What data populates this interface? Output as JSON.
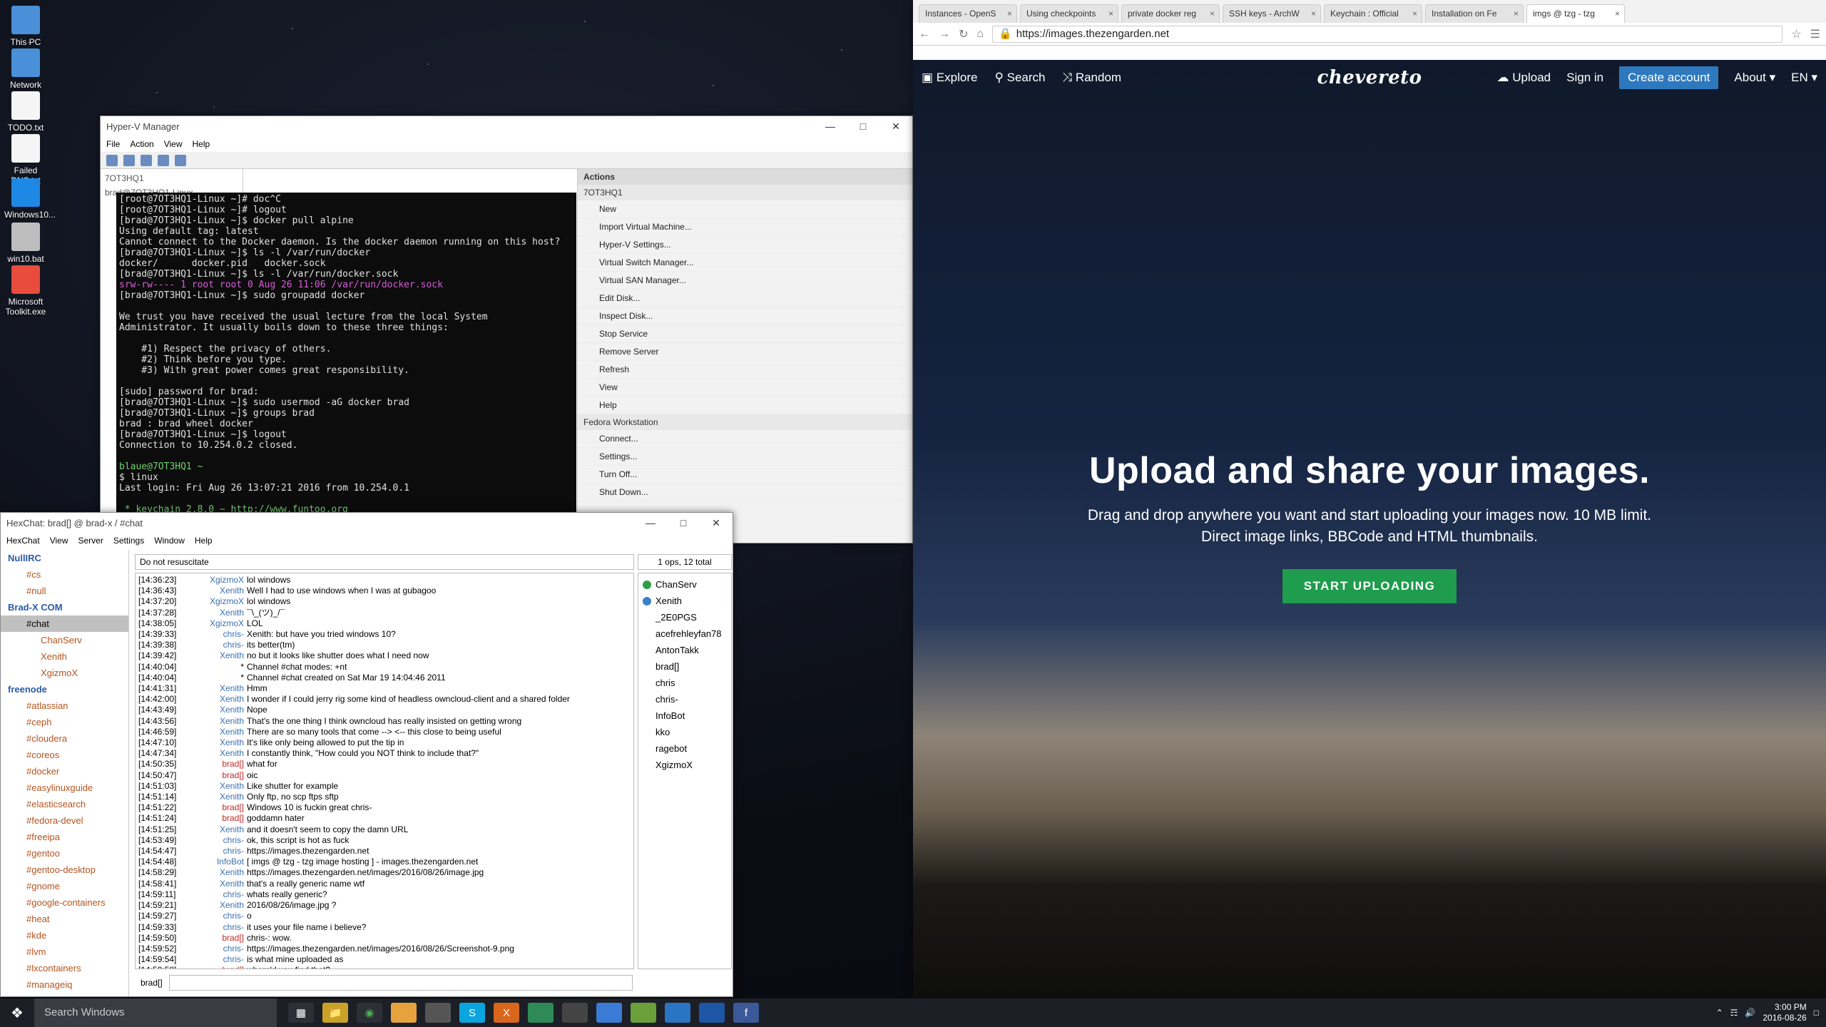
{
  "desktop": {
    "icons": [
      {
        "label": "This PC"
      },
      {
        "label": "Network"
      },
      {
        "label": "TODO.txt"
      },
      {
        "label": "Failed DNS.txt"
      },
      {
        "label": "Windows10..."
      },
      {
        "label": "win10.bat"
      },
      {
        "label": "Microsoft Toolkit.exe"
      }
    ]
  },
  "hyperv": {
    "title": "Hyper-V Manager",
    "menu": [
      "File",
      "Action",
      "View",
      "Help"
    ],
    "tree_item": "7OT3HQ1",
    "vm_tab": "brad@7OT3HQ1-Linux",
    "actions_header": "Actions",
    "actions_host": "7OT3HQ1",
    "actions": [
      "New",
      "Import Virtual Machine...",
      "Hyper-V Settings...",
      "Virtual Switch Manager...",
      "Virtual SAN Manager...",
      "Edit Disk...",
      "Inspect Disk...",
      "Stop Service",
      "Remove Server",
      "Refresh",
      "View",
      "Help"
    ],
    "actions_vm": "Fedora Workstation",
    "vm_actions": [
      "Connect...",
      "Settings...",
      "Turn Off...",
      "Shut Down..."
    ]
  },
  "terminal": {
    "lines": [
      {
        "t": "[root@7OT3HQ1-Linux ~]# doc^C",
        "c": ""
      },
      {
        "t": "[root@7OT3HQ1-Linux ~]# logout",
        "c": ""
      },
      {
        "t": "[brad@7OT3HQ1-Linux ~]$ docker pull alpine",
        "c": ""
      },
      {
        "t": "Using default tag: latest",
        "c": ""
      },
      {
        "t": "Cannot connect to the Docker daemon. Is the docker daemon running on this host?",
        "c": ""
      },
      {
        "t": "[brad@7OT3HQ1-Linux ~]$ ls -l /var/run/docker",
        "c": ""
      },
      {
        "t": "docker/      docker.pid   docker.sock",
        "c": ""
      },
      {
        "t": "[brad@7OT3HQ1-Linux ~]$ ls -l /var/run/docker.sock",
        "c": ""
      },
      {
        "t": "srw-rw---- 1 root root 0 Aug 26 11:06 /var/run/docker.sock",
        "c": "hl"
      },
      {
        "t": "[brad@7OT3HQ1-Linux ~]$ sudo groupadd docker",
        "c": ""
      },
      {
        "t": "",
        "c": ""
      },
      {
        "t": "We trust you have received the usual lecture from the local System",
        "c": ""
      },
      {
        "t": "Administrator. It usually boils down to these three things:",
        "c": ""
      },
      {
        "t": "",
        "c": ""
      },
      {
        "t": "    #1) Respect the privacy of others.",
        "c": ""
      },
      {
        "t": "    #2) Think before you type.",
        "c": ""
      },
      {
        "t": "    #3) With great power comes great responsibility.",
        "c": ""
      },
      {
        "t": "",
        "c": ""
      },
      {
        "t": "[sudo] password for brad:",
        "c": ""
      },
      {
        "t": "[brad@7OT3HQ1-Linux ~]$ sudo usermod -aG docker brad",
        "c": ""
      },
      {
        "t": "[brad@7OT3HQ1-Linux ~]$ groups brad",
        "c": ""
      },
      {
        "t": "brad : brad wheel docker",
        "c": ""
      },
      {
        "t": "[brad@7OT3HQ1-Linux ~]$ logout",
        "c": ""
      },
      {
        "t": "Connection to 10.254.0.2 closed.",
        "c": ""
      },
      {
        "t": "",
        "c": ""
      },
      {
        "t": "blaue@7OT3HQ1 ~",
        "c": "prompt"
      },
      {
        "t": "$ linux",
        "c": ""
      },
      {
        "t": "Last login: Fri Aug 26 13:07:21 2016 from 10.254.0.1",
        "c": ""
      },
      {
        "t": "",
        "c": ""
      },
      {
        "t": " * keychain 2.8.0 ~ http://www.funtoo.org",
        "c": "tty"
      }
    ]
  },
  "hexchat": {
    "title": "HexChat: brad[] @ brad-x / #chat",
    "menu": [
      "HexChat",
      "View",
      "Server",
      "Settings",
      "Window",
      "Help"
    ],
    "tree": [
      {
        "label": "NullIRC",
        "kind": "net"
      },
      {
        "label": "#cs",
        "kind": "chan"
      },
      {
        "label": "#null",
        "kind": "chan"
      },
      {
        "label": "Brad-X COM",
        "kind": "net"
      },
      {
        "label": "#chat",
        "kind": "chan sel"
      },
      {
        "label": "ChanServ",
        "kind": "user"
      },
      {
        "label": "Xenith",
        "kind": "user"
      },
      {
        "label": "XgizmoX",
        "kind": "user"
      },
      {
        "label": "freenode",
        "kind": "net"
      },
      {
        "label": "#atlassian",
        "kind": "chan"
      },
      {
        "label": "#ceph",
        "kind": "chan"
      },
      {
        "label": "#cloudera",
        "kind": "chan"
      },
      {
        "label": "#coreos",
        "kind": "chan"
      },
      {
        "label": "#docker",
        "kind": "chan"
      },
      {
        "label": "#easylinuxguide",
        "kind": "chan"
      },
      {
        "label": "#elasticsearch",
        "kind": "chan"
      },
      {
        "label": "#fedora-devel",
        "kind": "chan"
      },
      {
        "label": "#freeipa",
        "kind": "chan"
      },
      {
        "label": "#gentoo",
        "kind": "chan"
      },
      {
        "label": "#gentoo-desktop",
        "kind": "chan"
      },
      {
        "label": "#gnome",
        "kind": "chan"
      },
      {
        "label": "#google-containers",
        "kind": "chan"
      },
      {
        "label": "#heat",
        "kind": "chan"
      },
      {
        "label": "#kde",
        "kind": "chan"
      },
      {
        "label": "#lvm",
        "kind": "chan"
      },
      {
        "label": "#lxcontainers",
        "kind": "chan"
      },
      {
        "label": "#manageiq",
        "kind": "chan"
      }
    ],
    "topic": "Do not resuscitate",
    "ops": "1 ops, 12 total",
    "log": [
      {
        "ts": "[14:36:23]",
        "nick": "XgizmoX",
        "color": "#3a6fb0",
        "msg": "lol windows"
      },
      {
        "ts": "[14:36:43]",
        "nick": "Xenith",
        "color": "#3a6fb0",
        "msg": "Well I had to use windows when I was at gubagoo"
      },
      {
        "ts": "[14:37:20]",
        "nick": "XgizmoX",
        "color": "#3a6fb0",
        "msg": "lol windows"
      },
      {
        "ts": "[14:37:28]",
        "nick": "Xenith",
        "color": "#3a6fb0",
        "msg": "¯\\_(ツ)_/¯"
      },
      {
        "ts": "[14:38:05]",
        "nick": "XgizmoX",
        "color": "#3a6fb0",
        "msg": "LOL"
      },
      {
        "ts": "[14:39:33]",
        "nick": "chris-",
        "color": "#3a6fb0",
        "msg": "Xenith: but have you tried windows 10?"
      },
      {
        "ts": "[14:39:38]",
        "nick": "chris-",
        "color": "#3a6fb0",
        "msg": "its better(tm)"
      },
      {
        "ts": "[14:39:42]",
        "nick": "Xenith",
        "color": "#3a6fb0",
        "msg": "no but it looks like shutter does what I need now"
      },
      {
        "ts": "[14:40:04]",
        "nick": "*",
        "color": "#000",
        "msg": "Channel #chat modes: +nt"
      },
      {
        "ts": "[14:40:04]",
        "nick": "*",
        "color": "#000",
        "msg": "Channel #chat created on Sat Mar 19 14:04:46 2011"
      },
      {
        "ts": "[14:41:31]",
        "nick": "Xenith",
        "color": "#3a6fb0",
        "msg": "Hmm"
      },
      {
        "ts": "[14:42:00]",
        "nick": "Xenith",
        "color": "#3a6fb0",
        "msg": "I wonder if I could jerry rig some kind of headless owncloud-client and a shared folder"
      },
      {
        "ts": "[14:43:49]",
        "nick": "Xenith",
        "color": "#3a6fb0",
        "msg": "Nope"
      },
      {
        "ts": "[14:43:56]",
        "nick": "Xenith",
        "color": "#3a6fb0",
        "msg": "That's the one thing I think owncloud has really insisted on getting wrong"
      },
      {
        "ts": "[14:46:59]",
        "nick": "Xenith",
        "color": "#3a6fb0",
        "msg": "There are so many tools that come --> <-- this close to being useful"
      },
      {
        "ts": "[14:47:10]",
        "nick": "Xenith",
        "color": "#3a6fb0",
        "msg": "It's like only being allowed to put the tip in"
      },
      {
        "ts": "[14:47:34]",
        "nick": "Xenith",
        "color": "#3a6fb0",
        "msg": "I constantly think, \"How could you NOT think to include that?\""
      },
      {
        "ts": "[14:50:35]",
        "nick": "brad[]",
        "color": "#c62828",
        "msg": "what for"
      },
      {
        "ts": "[14:50:47]",
        "nick": "brad[]",
        "color": "#c62828",
        "msg": "oic"
      },
      {
        "ts": "[14:51:03]",
        "nick": "Xenith",
        "color": "#3a6fb0",
        "msg": "Like shutter for example"
      },
      {
        "ts": "[14:51:14]",
        "nick": "Xenith",
        "color": "#3a6fb0",
        "msg": "Only ftp, no scp ftps sftp"
      },
      {
        "ts": "[14:51:22]",
        "nick": "brad[]",
        "color": "#c62828",
        "msg": "Windows 10 is fuckin great chris-"
      },
      {
        "ts": "[14:51:24]",
        "nick": "brad[]",
        "color": "#c62828",
        "msg": "goddamn hater"
      },
      {
        "ts": "[14:51:25]",
        "nick": "Xenith",
        "color": "#3a6fb0",
        "msg": "and it doesn't seem to copy the damn URL"
      },
      {
        "ts": "[14:53:49]",
        "nick": "chris-",
        "color": "#3a6fb0",
        "msg": "ok, this script is hot as fuck"
      },
      {
        "ts": "[14:54:47]",
        "nick": "chris-",
        "color": "#3a6fb0",
        "msg": "https://images.thezengarden.net"
      },
      {
        "ts": "[14:54:48]",
        "nick": "InfoBot",
        "color": "#3a6fb0",
        "msg": "[ imgs @ tzg - tzg image hosting ] - images.thezengarden.net"
      },
      {
        "ts": "[14:58:29]",
        "nick": "Xenith",
        "color": "#3a6fb0",
        "msg": "https://images.thezengarden.net/images/2016/08/26/image.jpg"
      },
      {
        "ts": "[14:58:41]",
        "nick": "Xenith",
        "color": "#3a6fb0",
        "msg": "that's a really generic name wtf"
      },
      {
        "ts": "[14:59:11]",
        "nick": "chris-",
        "color": "#3a6fb0",
        "msg": "whats really generic?"
      },
      {
        "ts": "[14:59:21]",
        "nick": "Xenith",
        "color": "#3a6fb0",
        "msg": "2016/08/26/image.jpg ?"
      },
      {
        "ts": "[14:59:27]",
        "nick": "chris-",
        "color": "#3a6fb0",
        "msg": "o"
      },
      {
        "ts": "[14:59:33]",
        "nick": "chris-",
        "color": "#3a6fb0",
        "msg": "it uses your file name i believe?"
      },
      {
        "ts": "[14:59:50]",
        "nick": "brad[]",
        "color": "#c62828",
        "msg": "chris-: wow."
      },
      {
        "ts": "[14:59:52]",
        "nick": "chris-",
        "color": "#3a6fb0",
        "msg": "https://images.thezengarden.net/images/2016/08/26/Screenshot-9.png"
      },
      {
        "ts": "[14:59:54]",
        "nick": "chris-",
        "color": "#3a6fb0",
        "msg": "is what mine uploaded as"
      },
      {
        "ts": "[14:59:58]",
        "nick": "brad[]",
        "color": "#c62828",
        "msg": "where'd you find that?"
      }
    ],
    "users": [
      {
        "name": "ChanServ",
        "dot": "#2ea043"
      },
      {
        "name": "Xenith",
        "dot": "#3b82c4"
      },
      {
        "name": "_2E0PGS",
        "dot": ""
      },
      {
        "name": "acefrehleyfan78",
        "dot": ""
      },
      {
        "name": "AntonTakk",
        "dot": ""
      },
      {
        "name": "brad[]",
        "dot": ""
      },
      {
        "name": "chris",
        "dot": ""
      },
      {
        "name": "chris-",
        "dot": ""
      },
      {
        "name": "InfoBot",
        "dot": ""
      },
      {
        "name": "kko",
        "dot": ""
      },
      {
        "name": "ragebot",
        "dot": ""
      },
      {
        "name": "XgizmoX",
        "dot": ""
      }
    ],
    "input_nick": "brad[]",
    "input_value": ""
  },
  "chrome": {
    "tabs": [
      {
        "label": "Instances - OpenS",
        "active": false
      },
      {
        "label": "Using checkpoints",
        "active": false
      },
      {
        "label": "private docker reg",
        "active": false
      },
      {
        "label": "SSH keys - ArchW",
        "active": false
      },
      {
        "label": "Keychain : Official",
        "active": false
      },
      {
        "label": "Installation on Fe",
        "active": false
      },
      {
        "label": "imgs @ tzg - tzg",
        "active": true
      }
    ],
    "url_scheme": "https://",
    "url_host": "images.thezengarden.net"
  },
  "site": {
    "nav_left": [
      "Explore",
      "Search",
      "Random"
    ],
    "logo": "chevereto",
    "upload": "Upload",
    "signin": "Sign in",
    "create": "Create account",
    "about": "About",
    "lang": "EN",
    "headline": "Upload and share your images.",
    "subline": "Drag and drop anywhere you want and start uploading your images now. 10 MB limit. Direct image links, BBCode and HTML thumbnails.",
    "cta": "START UPLOADING"
  },
  "taskbar": {
    "search_placeholder": "Search Windows",
    "time": "3:00 PM",
    "date": "2016-08-26"
  }
}
